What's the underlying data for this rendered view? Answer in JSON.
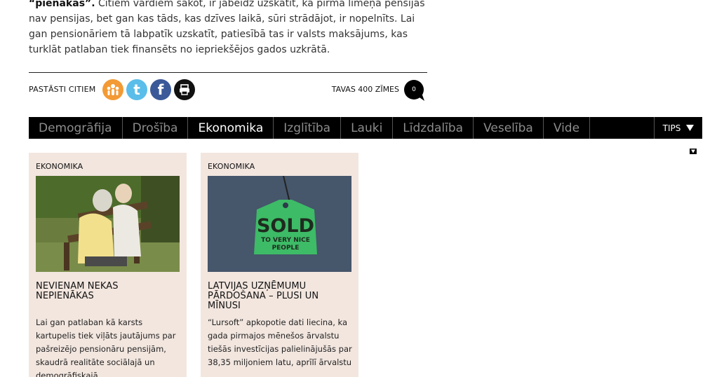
{
  "article": {
    "lead_bold": "“pienākas”.",
    "paragraph": " Citiem vārdiem sakot, ir jābeidz uzskatīt, ka pirmā līmeņa pensijas nav pensijas, bet gan kas tāds, kas dzīves laikā, sūri strādājot, ir nopelnīts. Lai gan pensionāriem tā labpatīk uzskatīt, patiesībā tas ir valsts maksājums, kas turklāt patlaban tiek finansēts no iepriekšējos gados uzkrātā."
  },
  "share": {
    "label": "PASTĀSTI CITIEM",
    "icons": [
      "draugiem-icon",
      "twitter-icon",
      "facebook-icon",
      "print-icon"
    ],
    "twitter_glyph": "t",
    "facebook_glyph": "f",
    "chars_label": "TAVAS 400 ZĪMES",
    "comment_count": "0"
  },
  "nav": {
    "items": [
      "Demogrāfija",
      "Drošība",
      "Ekonomika",
      "Izglītība",
      "Lauki",
      "Līdzdalība",
      "Veselība",
      "Vide"
    ],
    "active_index": 2,
    "tips_label": "TIPS"
  },
  "cards": [
    {
      "category": "EKONOMIKA",
      "title": "NEVIENAM NEKAS NEPIENĀKAS",
      "text": "Lai gan patlaban kā karsts kartupelis tiek viļāts jautājums par pašreizējo pensionāru pensijām, skaudrā realitāte sociālajā un demogrāfiskajā"
    },
    {
      "category": "EKONOMIKA",
      "title": "LATVIJAS UZŅĒMUMU PĀRDOŠANA – PLUSI UN MĪNUSI",
      "text": "“Lursoft” apkopotie dati liecina, ka gada pirmajos mēnešos ārvalstu tiešās investīcijas palielinājušās par 38,35 miljoniem latu, aprīlī ārvalstu",
      "image_sign_big": "SOLD",
      "image_sign_small_1": "TO VERY NICE",
      "image_sign_small_2": "PEOPLE"
    }
  ],
  "colors": {
    "card_bg": "#f2e6df",
    "nav_bg": "#000000",
    "nav_inactive": "#8d8d8d",
    "draugiem": "#f39a34",
    "twitter": "#5bbde9",
    "facebook": "#3b5998"
  }
}
